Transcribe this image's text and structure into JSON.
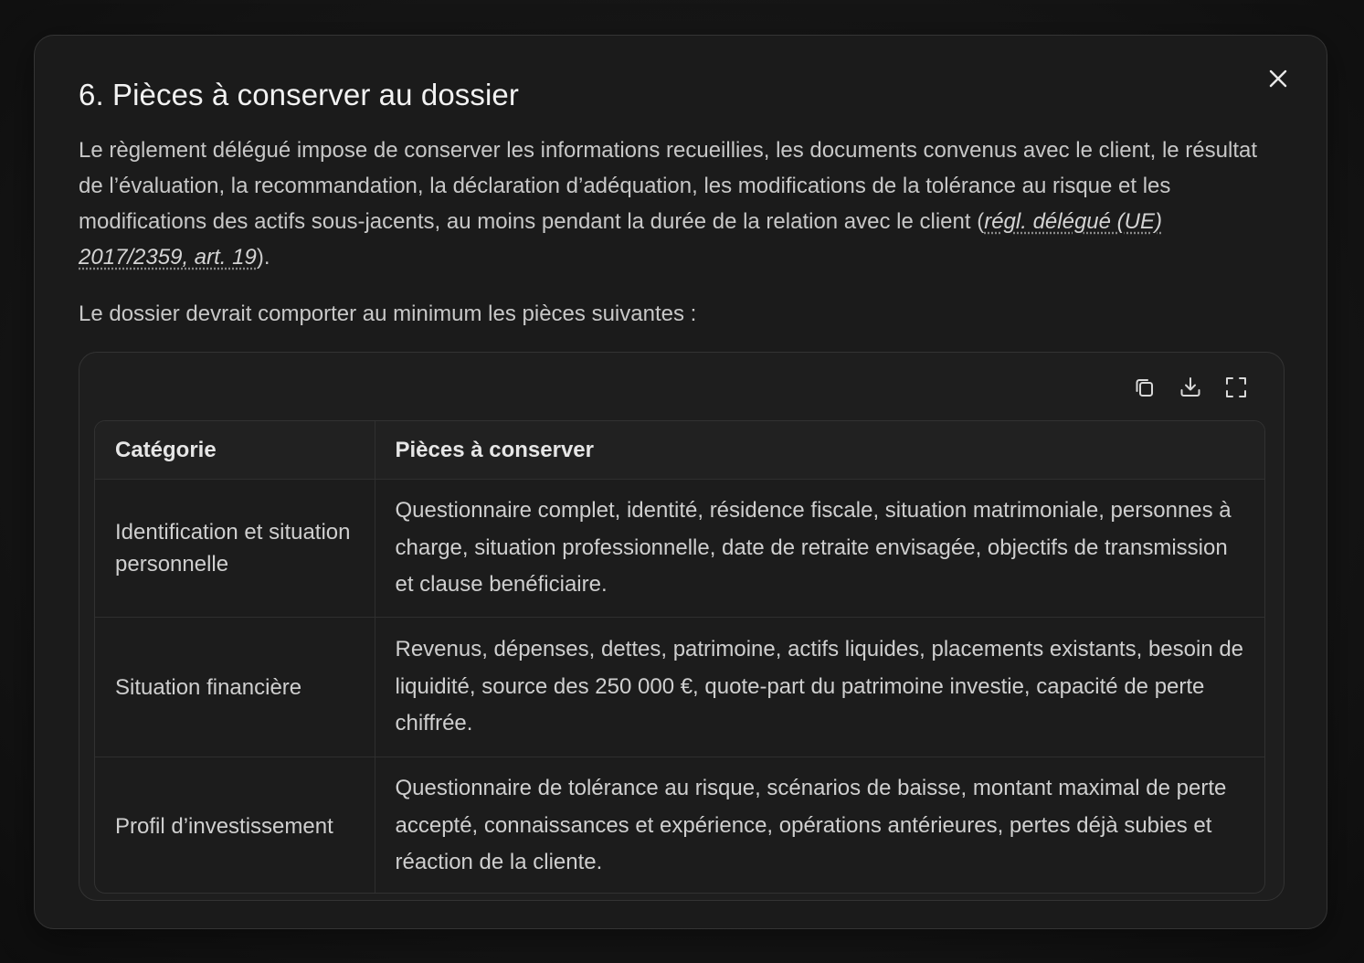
{
  "modal": {
    "title": "6. Pièces à conserver au dossier",
    "intro_text": "Le règlement délégué impose de conserver les informations recueillies, les documents convenus avec le client, le résultat de l’évaluation, la recommandation, la déclaration d’adéquation, les modifications de la tolérance au risque et les modifications des actifs sous-jacents, au moins pendant la durée de la relation avec le client (",
    "intro_link": "régl. délégué (UE) 2017/2359, art. 19",
    "intro_end": ").",
    "lead": "Le dossier devrait comporter au minimum les pièces suivantes :",
    "close_icon": "close-icon"
  },
  "toolbar": {
    "icons": [
      "copy-icon",
      "download-icon",
      "fullscreen-icon"
    ]
  },
  "table": {
    "headers": [
      "Catégorie",
      "Pièces à conserver"
    ],
    "rows": [
      {
        "category": "Identification et situation personnelle",
        "pieces": "Questionnaire complet, identité, résidence fiscale, situation matrimoniale, personnes à charge, situation professionnelle, date de retraite envisagée, objectifs de transmission et clause benéficiaire."
      },
      {
        "category": "Situation financière",
        "pieces": "Revenus, dépenses, dettes, patrimoine, actifs liquides, placements existants, besoin de liquidité, source des 250 000 €, quote-part du patrimoine investie, capacité de perte chiffrée."
      },
      {
        "category": "Profil d’investissement",
        "pieces": "Questionnaire de tolérance au risque, scénarios de baisse, montant maximal de perte accepté, connaissances et expérience, opérations antérieures, pertes déjà subies et réaction de la cliente."
      }
    ]
  }
}
